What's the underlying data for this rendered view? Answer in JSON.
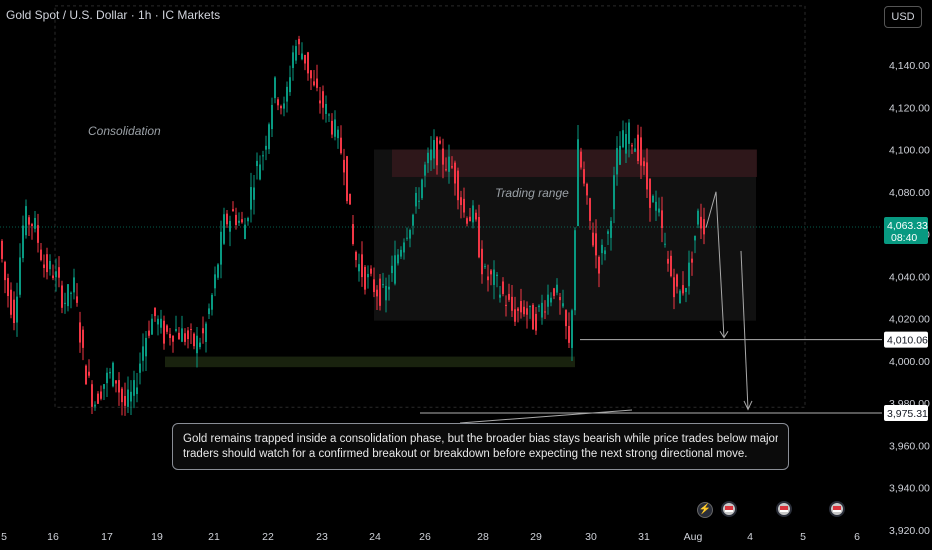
{
  "header": {
    "title": "Gold Spot / U.S. Dollar · 1h · IC Markets",
    "currency_button": "USD"
  },
  "chart_data": {
    "type": "candlestick",
    "symbol": "Gold Spot / U.S. Dollar",
    "timeframe": "1h",
    "broker": "IC Markets",
    "currency": "USD",
    "y_ticks": [
      4140,
      4120,
      4100,
      4080,
      4060,
      4040,
      4020,
      4000,
      3980,
      3960,
      3940,
      3920
    ],
    "y_tick_labels": [
      "4,140.00",
      "4,120.00",
      "4,100.00",
      "4,080.00",
      "4,060.00",
      "4,040.00",
      "4,020.00",
      "4,000.00",
      "3,980.00",
      "3,960.00",
      "3,940.00",
      "3,920.00"
    ],
    "x_tick_labels": [
      "5",
      "16",
      "17",
      "19",
      "21",
      "22",
      "23",
      "24",
      "26",
      "28",
      "29",
      "30",
      "31",
      "Aug",
      "4",
      "5",
      "6"
    ],
    "current_price": {
      "value": 4063.33,
      "label": "4,063.33",
      "countdown": "08:40",
      "color": "#089981"
    },
    "levels": [
      {
        "value": 4010.06,
        "label": "4,010.06"
      },
      {
        "value": 3975.31,
        "label": "3,975.31"
      }
    ],
    "annotations": {
      "consolidation": "Consolidation",
      "trading_range": "Trading range",
      "note_line1": "Gold remains trapped inside a consolidation phase, but the broader bias stays bearish while price trades below major resistance",
      "note_line2": "traders should watch for a confirmed breakout or breakdown before expecting the next strong directional move."
    },
    "colors": {
      "up": "#089981",
      "down": "#f23645",
      "background": "#000000"
    },
    "anchors": [
      [
        0,
        4060
      ],
      [
        8,
        4035
      ],
      [
        16,
        4022
      ],
      [
        26,
        4068
      ],
      [
        36,
        4065
      ],
      [
        46,
        4045
      ],
      [
        56,
        4042
      ],
      [
        66,
        4028
      ],
      [
        76,
        4035
      ],
      [
        86,
        3998
      ],
      [
        96,
        3980
      ],
      [
        106,
        3990
      ],
      [
        116,
        3995
      ],
      [
        126,
        3978
      ],
      [
        136,
        3985
      ],
      [
        146,
        4010
      ],
      [
        156,
        4022
      ],
      [
        166,
        4012
      ],
      [
        176,
        4015
      ],
      [
        186,
        4012
      ],
      [
        196,
        4008
      ],
      [
        206,
        4012
      ],
      [
        216,
        4035
      ],
      [
        226,
        4065
      ],
      [
        236,
        4070
      ],
      [
        246,
        4062
      ],
      [
        256,
        4088
      ],
      [
        266,
        4100
      ],
      [
        276,
        4130
      ],
      [
        286,
        4118
      ],
      [
        296,
        4150
      ],
      [
        306,
        4145
      ],
      [
        316,
        4128
      ],
      [
        326,
        4120
      ],
      [
        336,
        4110
      ],
      [
        346,
        4095
      ],
      [
        356,
        4050
      ],
      [
        366,
        4040
      ],
      [
        376,
        4035
      ],
      [
        386,
        4030
      ],
      [
        396,
        4045
      ],
      [
        406,
        4060
      ],
      [
        416,
        4070
      ],
      [
        426,
        4090
      ],
      [
        436,
        4100
      ],
      [
        446,
        4095
      ],
      [
        456,
        4090
      ],
      [
        466,
        4070
      ],
      [
        476,
        4068
      ],
      [
        486,
        4040
      ],
      [
        496,
        4038
      ],
      [
        506,
        4030
      ],
      [
        516,
        4022
      ],
      [
        526,
        4025
      ],
      [
        536,
        4018
      ],
      [
        546,
        4028
      ],
      [
        556,
        4035
      ],
      [
        566,
        4020
      ],
      [
        572,
        4003
      ],
      [
        580,
        4100
      ],
      [
        590,
        4070
      ],
      [
        600,
        4045
      ],
      [
        610,
        4060
      ],
      [
        620,
        4100
      ],
      [
        630,
        4108
      ],
      [
        640,
        4100
      ],
      [
        650,
        4080
      ],
      [
        660,
        4070
      ],
      [
        670,
        4045
      ],
      [
        680,
        4030
      ],
      [
        690,
        4040
      ],
      [
        700,
        4068
      ],
      [
        706,
        4063
      ]
    ]
  },
  "events": [
    "lightning",
    "us-flag",
    "us-flag",
    "us-flag"
  ]
}
